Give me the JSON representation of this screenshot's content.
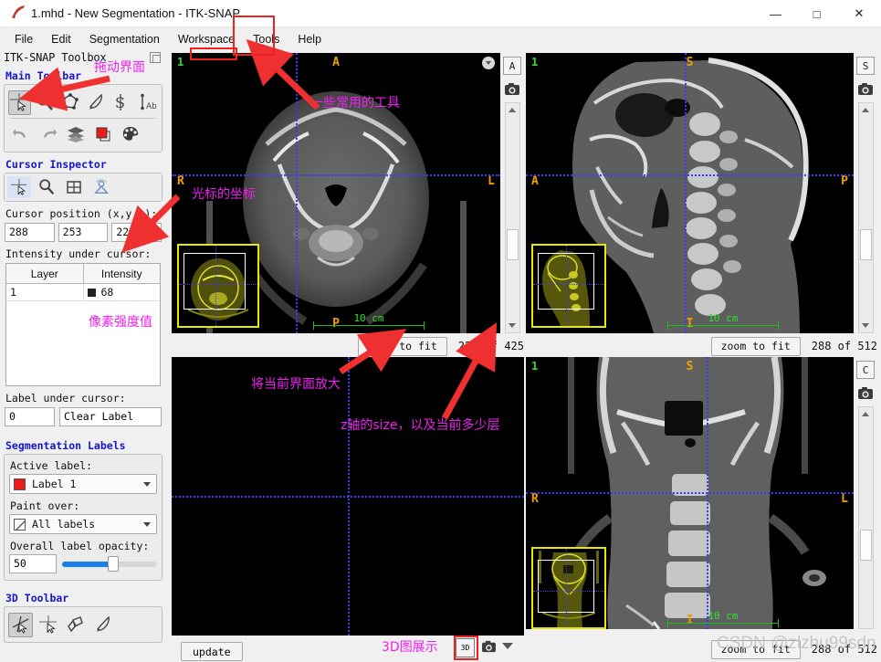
{
  "window": {
    "title": "1.mhd - New Segmentation - ITK-SNAP",
    "app_icon": "itksnap-logo-icon",
    "minimize": "—",
    "maximize": "□",
    "close": "✕"
  },
  "menu": {
    "items": [
      {
        "label": "File",
        "name": "menu-file"
      },
      {
        "label": "Edit",
        "name": "menu-edit"
      },
      {
        "label": "Segmentation",
        "name": "menu-segmentation"
      },
      {
        "label": "Workspace",
        "name": "menu-workspace"
      },
      {
        "label": "Tools",
        "name": "menu-tools"
      },
      {
        "label": "Help",
        "name": "menu-help"
      }
    ]
  },
  "toolbox": {
    "title": "ITK-SNAP Toolbox",
    "main_toolbar_title": "Main Toolbar",
    "main_tools": [
      {
        "name": "crosshair-tool-icon",
        "label": "Crosshair"
      },
      {
        "name": "zoom-pan-tool-icon",
        "label": "Zoom/Pan"
      },
      {
        "name": "polygon-tool-icon",
        "label": "Polygon"
      },
      {
        "name": "paintbrush-tool-icon",
        "label": "Paintbrush"
      },
      {
        "name": "snake-tool-icon",
        "label": "Active Contour"
      },
      {
        "name": "annotation-tool-icon",
        "label": "Annotation"
      }
    ],
    "action_tools": [
      {
        "name": "undo-icon",
        "label": "Undo"
      },
      {
        "name": "redo-icon",
        "label": "Redo"
      },
      {
        "name": "layers-icon",
        "label": "Layer Inspector"
      },
      {
        "name": "label-color-icon",
        "label": "Label Editor"
      },
      {
        "name": "palette-icon",
        "label": "Appearance"
      }
    ],
    "cursor_inspector_title": "Cursor Inspector",
    "inspector_tabs": [
      {
        "name": "inspector-tab-cursor-icon",
        "label": "Cursor"
      },
      {
        "name": "inspector-tab-zoom-icon",
        "label": "Zoom"
      },
      {
        "name": "inspector-tab-layout-icon",
        "label": "Layout"
      },
      {
        "name": "inspector-tab-3d-icon",
        "label": "3D"
      }
    ],
    "cursor_position_label": "Cursor position (x,y,z):",
    "cursor_position": {
      "x": "288",
      "y": "253",
      "z": "223"
    },
    "intensity_label": "Intensity under cursor:",
    "intensity_table": {
      "columns": [
        "Layer",
        "Intensity"
      ],
      "rows": [
        {
          "layer": "1",
          "intensity": "68"
        }
      ]
    },
    "label_under_cursor_label": "Label under cursor:",
    "label_under_cursor_id": "0",
    "label_under_cursor_name": "Clear Label",
    "segmentation_labels_title": "Segmentation Labels",
    "active_label_caption": "Active label:",
    "active_label_value": "Label 1",
    "active_label_color": "#ed1c1c",
    "paint_over_caption": "Paint over:",
    "paint_over_value": "All labels",
    "opacity_caption": "Overall label opacity:",
    "opacity_value": "50",
    "toolbar3d_title": "3D Toolbar",
    "tools3d": [
      {
        "name": "3d-crosshair-scalpel-icon",
        "label": "Scalpel"
      },
      {
        "name": "3d-crosshair-icon",
        "label": "Crosshair 3D"
      },
      {
        "name": "3d-spraypaint-icon",
        "label": "Spray Paint"
      },
      {
        "name": "3d-brush-icon",
        "label": "3D Brush"
      }
    ]
  },
  "views": {
    "axial": {
      "panel_name": "axial-view",
      "layer_number": "1",
      "orientation": {
        "top": "A",
        "left": "R",
        "right": "L",
        "bottom": "P"
      },
      "scale_label": "10  cm",
      "view_letter": "A",
      "zoom_to_fit": "zoom to fit",
      "slice_text": "223 of 425"
    },
    "sagittal": {
      "panel_name": "sagittal-view",
      "layer_number": "1",
      "orientation": {
        "top": "S",
        "left": "A",
        "right": "P",
        "bottom": "I"
      },
      "scale_label": "10  cm",
      "view_letter": "S",
      "zoom_to_fit": "zoom to fit",
      "slice_text": "288 of 512"
    },
    "coronal": {
      "panel_name": "coronal-view",
      "layer_number": "1",
      "orientation": {
        "top": "S",
        "left": "R",
        "right": "L",
        "bottom": "I"
      },
      "scale_label": "10  cm",
      "view_letter": "C",
      "zoom_to_fit": "zoom to fit",
      "slice_text": "288 of 512"
    },
    "render3d": {
      "panel_name": "render-3d-view",
      "update_button": "update",
      "button_3d": "3D"
    }
  },
  "annotations": [
    {
      "name": "annotation-drag-interface",
      "text": "拖动界面"
    },
    {
      "name": "annotation-common-tools",
      "text": "一些常用的工具"
    },
    {
      "name": "annotation-cursor-coordinates",
      "text": "光标的坐标"
    },
    {
      "name": "annotation-pixel-intensity",
      "text": "像素强度值"
    },
    {
      "name": "annotation-zoom-current-view",
      "text": "将当前界面放大"
    },
    {
      "name": "annotation-z-axis-size",
      "text": "z轴的size，以及当前多少层"
    },
    {
      "name": "annotation-3d-display",
      "text": "3D图展示"
    }
  ],
  "watermark": {
    "text": "CSDN @zlzhu99sdn"
  },
  "colors": {
    "annotation_pink": "#f020f0",
    "highlight_red": "#ef2020",
    "crosshair_blue": "#3a3aff",
    "orientation_orange": "#f0a000",
    "scale_green": "#2ee02e",
    "section_blue": "#1515d0",
    "thumbnail_yellow": "#e8e800"
  }
}
